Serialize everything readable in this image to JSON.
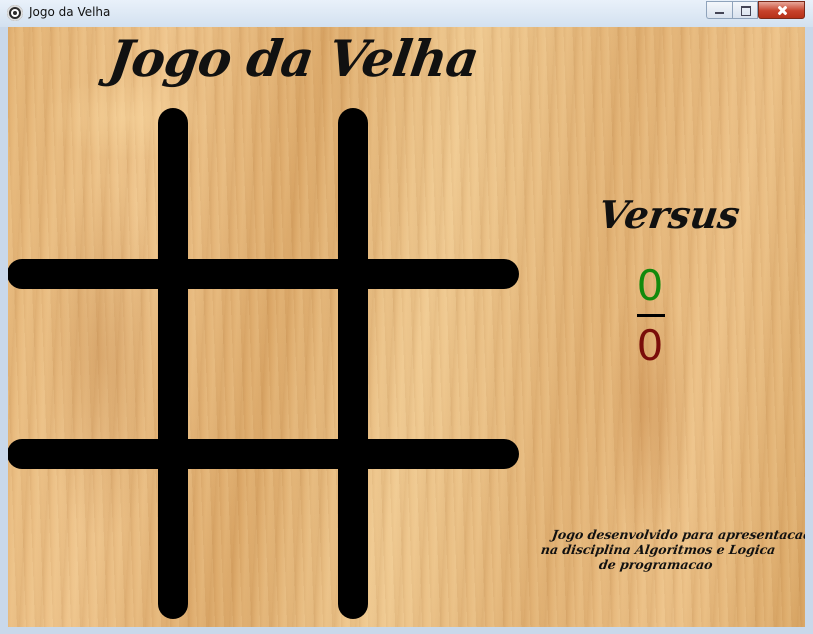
{
  "window": {
    "title": "Jogo da Velha",
    "icon": "app-icon"
  },
  "game": {
    "title": "Jogo da Velha",
    "board": [
      [
        "",
        "",
        ""
      ],
      [
        "",
        "",
        ""
      ],
      [
        "",
        "",
        ""
      ]
    ]
  },
  "scoreboard": {
    "label": "Versus",
    "player_x_score": "0",
    "player_o_score": "0",
    "colors": {
      "x": "#128a0c",
      "o": "#7a0d0a"
    }
  },
  "credits": {
    "line1": "Jogo desenvolvido para apresentacao",
    "line2": "na disciplina Algoritmos e Logica",
    "line3": "de programacao"
  }
}
